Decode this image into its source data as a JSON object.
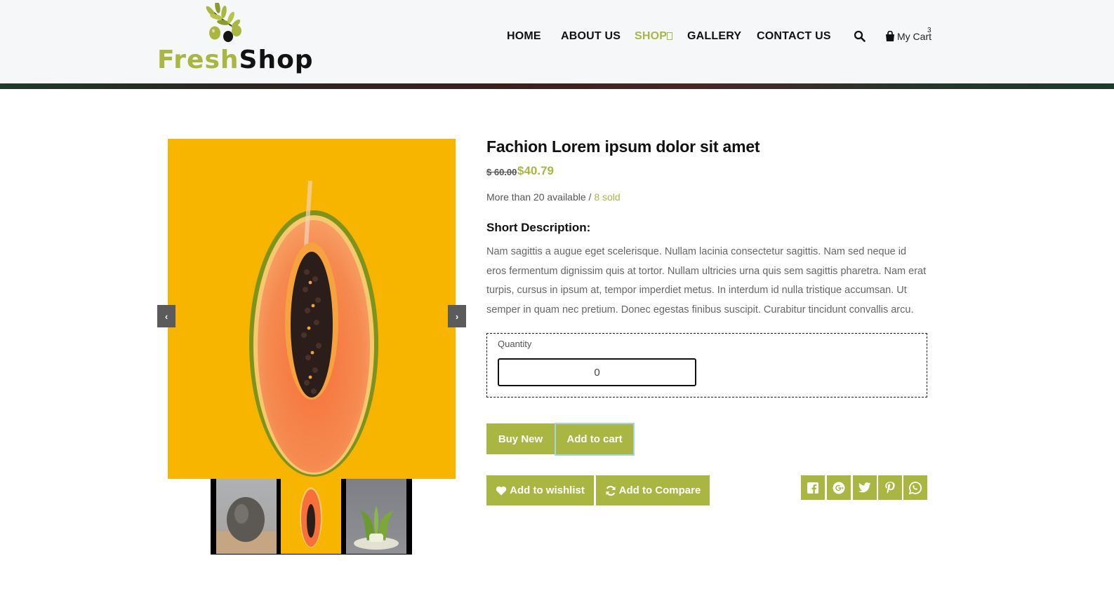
{
  "header": {
    "logo": {
      "part1": "Fresh",
      "part2": "Shop"
    },
    "nav": [
      {
        "label": "HOME",
        "active": false
      },
      {
        "label": "ABOUT US",
        "active": false
      },
      {
        "label": "SHOP",
        "active": true
      },
      {
        "label": "GALLERY",
        "active": false
      },
      {
        "label": "CONTACT US",
        "active": false
      }
    ],
    "search_icon": "search-icon",
    "cart": {
      "label": "My Cart",
      "count": "3",
      "icon": "shopping-bag-icon"
    }
  },
  "gallery": {
    "prev_icon": "chevron-left-icon",
    "next_icon": "chevron-right-icon",
    "thumbnails": [
      "avocado",
      "papaya",
      "bok choy"
    ],
    "active_thumbnail": 1
  },
  "product": {
    "title": "Fachion Lorem ipsum dolor sit amet",
    "price_old": "$ 60.00",
    "price_new": "$40.79",
    "stock_text": "More than 20 available /",
    "sold_text": "8 sold",
    "short_desc_title": "Short Description:",
    "description": "Nam sagittis a augue eget scelerisque. Nullam lacinia consectetur sagittis. Nam sed neque id eros fermentum dignissim quis at tortor. Nullam ultricies urna quis sem sagittis pharetra. Nam erat turpis, cursus in ipsum at, tempor imperdiet metus. In interdum id nulla tristique accumsan. Ut semper in quam nec pretium. Donec egestas finibus suscipit. Curabitur tincidunt convallis arcu.",
    "quantity_label": "Quantity",
    "quantity_value": "0"
  },
  "actions": {
    "buy_label": "Buy New",
    "cart_label": "Add to cart",
    "wishlist_label": "Add to wishlist",
    "compare_label": "Add to Compare"
  },
  "share": [
    "facebook-icon",
    "google-plus-icon",
    "twitter-icon",
    "pinterest-icon",
    "whatsapp-icon"
  ],
  "colors": {
    "accent": "#a9b641",
    "header_bg": "#f5f7f8",
    "text": "#111111",
    "muted": "#666666"
  }
}
